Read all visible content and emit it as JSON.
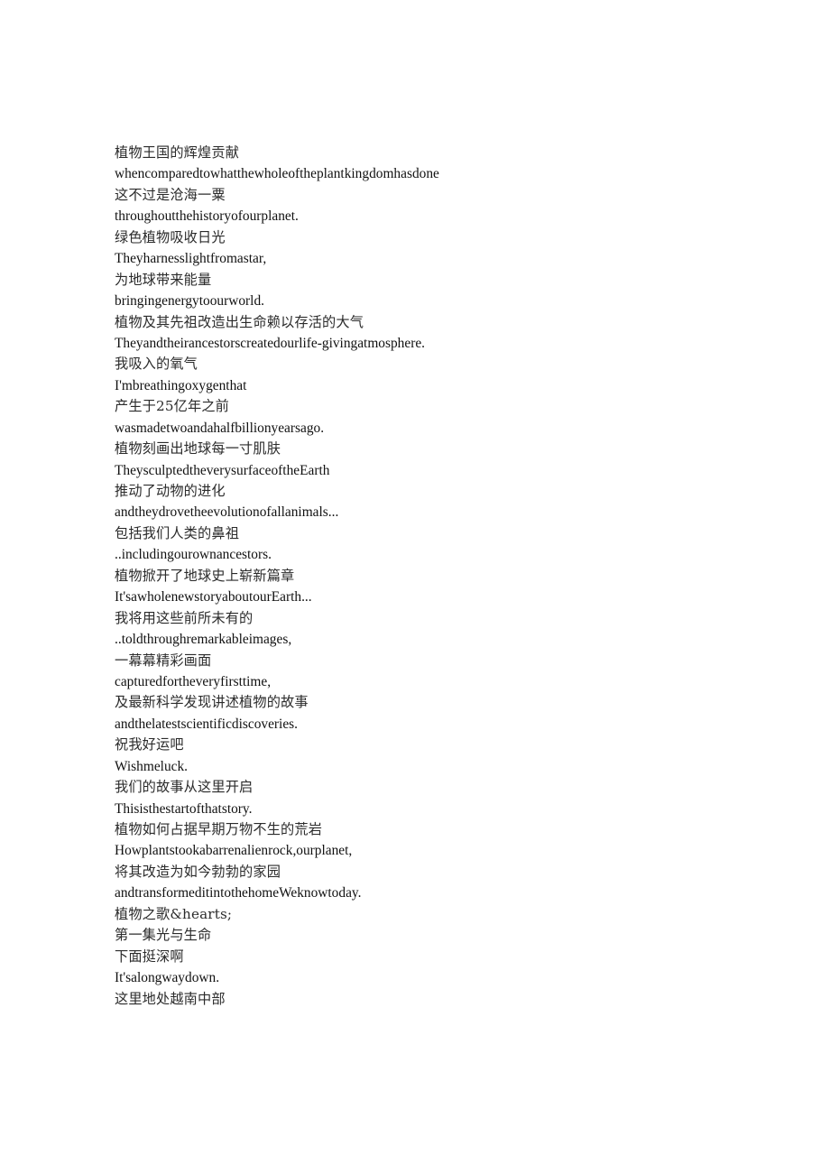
{
  "document": {
    "background_color": "#ffffff",
    "text_color": "#111111",
    "cjk_text_color": "#2b2b2b",
    "lines": [
      {
        "text": "植物王国的辉煌贡献",
        "script": "cjk"
      },
      {
        "text": "whencomparedtowhatthewholeoftheplantkingdomhasdone",
        "script": "latin"
      },
      {
        "text": "这不过是沧海一粟",
        "script": "cjk"
      },
      {
        "text": "throughoutthehistoryofourplanet.",
        "script": "latin"
      },
      {
        "text": "绿色植物吸收日光",
        "script": "cjk"
      },
      {
        "text": "Theyharnesslightfromastar,",
        "script": "latin"
      },
      {
        "text": "为地球带来能量",
        "script": "cjk"
      },
      {
        "text": "bringingenergytoourworld.",
        "script": "latin"
      },
      {
        "text": "植物及其先祖改造出生命赖以存活的大气",
        "script": "cjk"
      },
      {
        "text": "Theyandtheirancestorscreatedourlife-givingatmosphere.",
        "script": "latin"
      },
      {
        "text": "我吸入的氧气",
        "script": "cjk"
      },
      {
        "text": "I'mbreathingoxygenthat",
        "script": "latin"
      },
      {
        "text": "产生于25亿年之前",
        "script": "cjk"
      },
      {
        "text": "wasmadetwoandahalfbillionyearsago.",
        "script": "latin"
      },
      {
        "text": "植物刻画出地球每一寸肌肤",
        "script": "cjk"
      },
      {
        "text": "TheysculptedtheverysurfaceoftheEarth",
        "script": "latin"
      },
      {
        "text": "推动了动物的进化",
        "script": "cjk"
      },
      {
        "text": "andtheydrovetheevolutionofallanimals...",
        "script": "latin"
      },
      {
        "text": "包括我们人类的鼻祖",
        "script": "cjk"
      },
      {
        "text": "..includingourownancestors.",
        "script": "latin"
      },
      {
        "text": "植物掀开了地球史上崭新篇章",
        "script": "cjk"
      },
      {
        "text": "It'sawholenewstoryaboutourEarth...",
        "script": "latin"
      },
      {
        "text": "我将用这些前所未有的",
        "script": "cjk"
      },
      {
        "text": "..toldthroughremarkableimages,",
        "script": "latin"
      },
      {
        "text": "一幕幕精彩画面",
        "script": "cjk"
      },
      {
        "text": "capturedfortheveryfirsttime,",
        "script": "latin"
      },
      {
        "text": "及最新科学发现讲述植物的故事",
        "script": "cjk"
      },
      {
        "text": "andthelatestscientificdiscoveries.",
        "script": "latin"
      },
      {
        "text": "祝我好运吧",
        "script": "cjk"
      },
      {
        "text": "Wishmeluck.",
        "script": "latin"
      },
      {
        "text": "我们的故事从这里开启",
        "script": "cjk"
      },
      {
        "text": "Thisisthestartofthatstory.",
        "script": "latin"
      },
      {
        "text": "植物如何占据早期万物不生的荒岩",
        "script": "cjk"
      },
      {
        "text": "Howplantstookabarrenalienrock,ourplanet,",
        "script": "latin"
      },
      {
        "text": "将其改造为如今勃勃的家园",
        "script": "cjk"
      },
      {
        "text": "andtransformeditintothehomeWeknowtoday.",
        "script": "latin"
      },
      {
        "text": "植物之歌&hearts;",
        "script": "cjk"
      },
      {
        "text": "第一集光与生命",
        "script": "cjk"
      },
      {
        "text": "下面挺深啊",
        "script": "cjk"
      },
      {
        "text": "It'salongwaydown.",
        "script": "latin"
      },
      {
        "text": "这里地处越南中部",
        "script": "cjk"
      }
    ]
  }
}
